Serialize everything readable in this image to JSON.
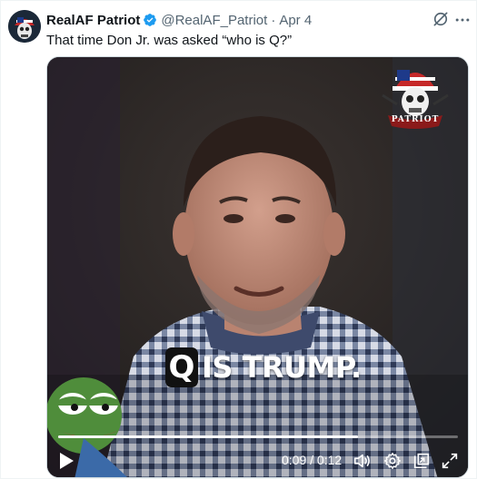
{
  "post": {
    "author_name": "RealAF Patriot",
    "handle": "@RealAF_Patriot",
    "separator": "·",
    "date": "Apr 4",
    "text": "That time Don Jr. was asked “who is Q?”"
  },
  "video": {
    "caption_letter": "Q",
    "caption_text": "IS TRUMP.",
    "watermark_text": "PATRIOT",
    "time_display": "0:09 / 0:12",
    "progress": 0.75
  },
  "icons": {
    "verified": "verified-badge-icon",
    "grok": "grok-icon",
    "more": "more-icon",
    "play": "play-icon",
    "volume": "volume-icon",
    "settings": "gear-icon",
    "popout": "popout-icon",
    "fullscreen": "fullscreen-icon"
  },
  "colors": {
    "verified_blue": "#1d9bf0",
    "secondary_text": "#536471",
    "primary_text": "#0f1419"
  }
}
